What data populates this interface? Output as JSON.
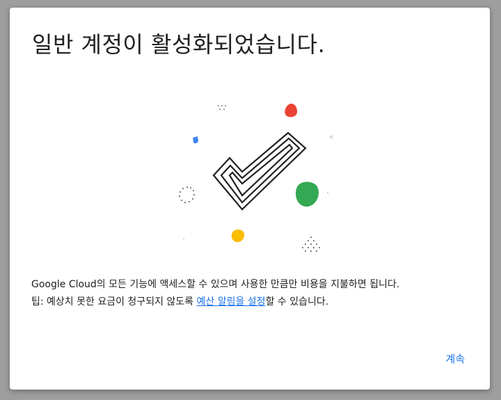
{
  "dialog": {
    "title": "일반 계정이 활성화되었습니다.",
    "illustration": {
      "icon": "checkmark-icon",
      "accent_colors": {
        "red": "#ea4335",
        "blue": "#4285f4",
        "green": "#34a853",
        "yellow": "#fbbc04"
      }
    },
    "body": {
      "line1": "Google Cloud의 모든 기능에 액세스할 수 있으며 사용한 만큼만 비용을 지불하면 됩니다.",
      "line2_prefix": "팁: 예상치 못한 요금이 청구되지 않도록 ",
      "line2_link": "예산 알림을 설정",
      "line2_suffix": "할 수 있습니다."
    },
    "continue_label": "계속"
  }
}
